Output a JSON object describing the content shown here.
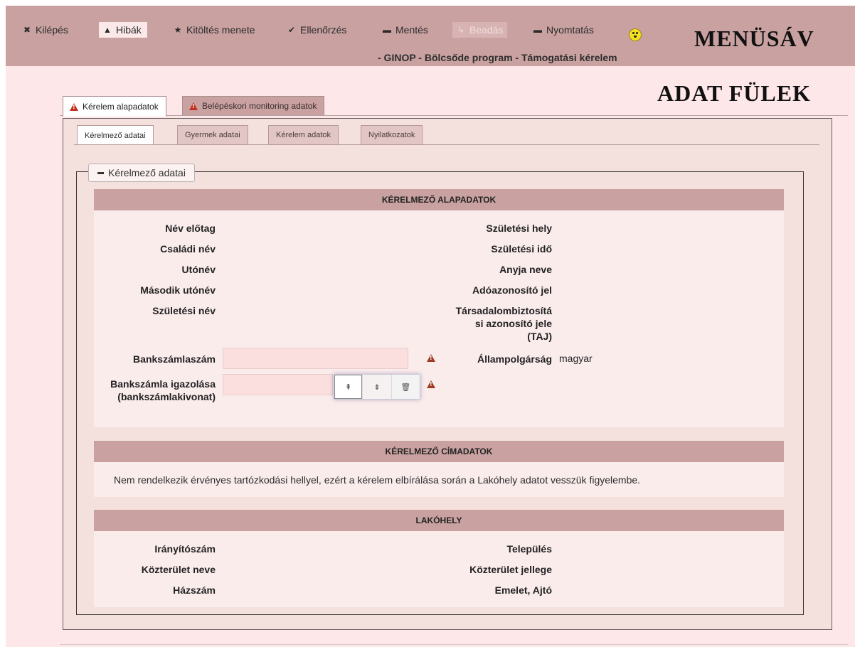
{
  "menu": {
    "items": [
      {
        "label": "Kilépés",
        "icon": "close-icon",
        "glyph": "✖"
      },
      {
        "label": "Hibák",
        "icon": "warning-icon",
        "glyph": "▲"
      },
      {
        "label": "Kitöltés menete",
        "icon": "star-icon",
        "glyph": "★"
      },
      {
        "label": "Ellenőrzés",
        "icon": "check-icon",
        "glyph": "✔"
      },
      {
        "label": "Mentés",
        "icon": "save-icon",
        "glyph": "▬"
      },
      {
        "label": "Beadás",
        "icon": "send-icon",
        "glyph": "↳"
      },
      {
        "label": "Nyomtatás",
        "icon": "print-icon",
        "glyph": "▬"
      }
    ],
    "title": "MENÜSÁV",
    "subtitle": "- GINOP - Bölcsőde program - Támogatási kérelem"
  },
  "tabs_title": "ADAT FÜLEK",
  "outer_tabs": [
    {
      "label": "Kérelem alapadatok"
    },
    {
      "label": "Belépéskori monitoring adatok"
    }
  ],
  "inner_tabs": [
    {
      "label": "Kérelmező adatai"
    },
    {
      "label": "Gyermek adatai"
    },
    {
      "label": "Kérelem adatok"
    },
    {
      "label": "Nyilatkozatok"
    }
  ],
  "fieldset_legend": "Kérelmező adatai",
  "sections": {
    "alapadatok": {
      "title": "KÉRELMEZŐ ALAPADATOK",
      "left_labels": [
        "Név előtag",
        "Családi név",
        "Utónév",
        "Második utónév",
        "Születési név"
      ],
      "right_labels": [
        "Születési hely",
        "Születési idő",
        "Anyja neve",
        "Adóazonosító jel",
        "Társadalombiztosítá si azonosító jele (TAJ)"
      ],
      "bank_account_label": "Bankszámlaszám",
      "bank_proof_label": "Bankszámla igazolása (bankszámlakivonat)",
      "citizenship_label": "Állampolgárság",
      "citizenship_value": "magyar",
      "upload_buttons": [
        "upload-icon",
        "download-icon",
        "trash-icon"
      ]
    },
    "cimadatok": {
      "title": "KÉRELMEZŐ CÍMADATOK",
      "notice": "Nem rendelkezik érvényes tartózkodási hellyel, ezért a kérelem elbírálása során a Lakóhely adatot vesszük figyelembe."
    },
    "lakohely": {
      "title": "LAKÓHELY",
      "left_labels": [
        "Irányítószám",
        "Közterület neve",
        "Házszám"
      ],
      "right_labels": [
        "Település",
        "Közterület jellege",
        "Emelet, Ajtó"
      ]
    }
  },
  "colors": {
    "menubar": "#c9a1a1",
    "page": "#fde7e9",
    "warning": "#c0311e"
  }
}
